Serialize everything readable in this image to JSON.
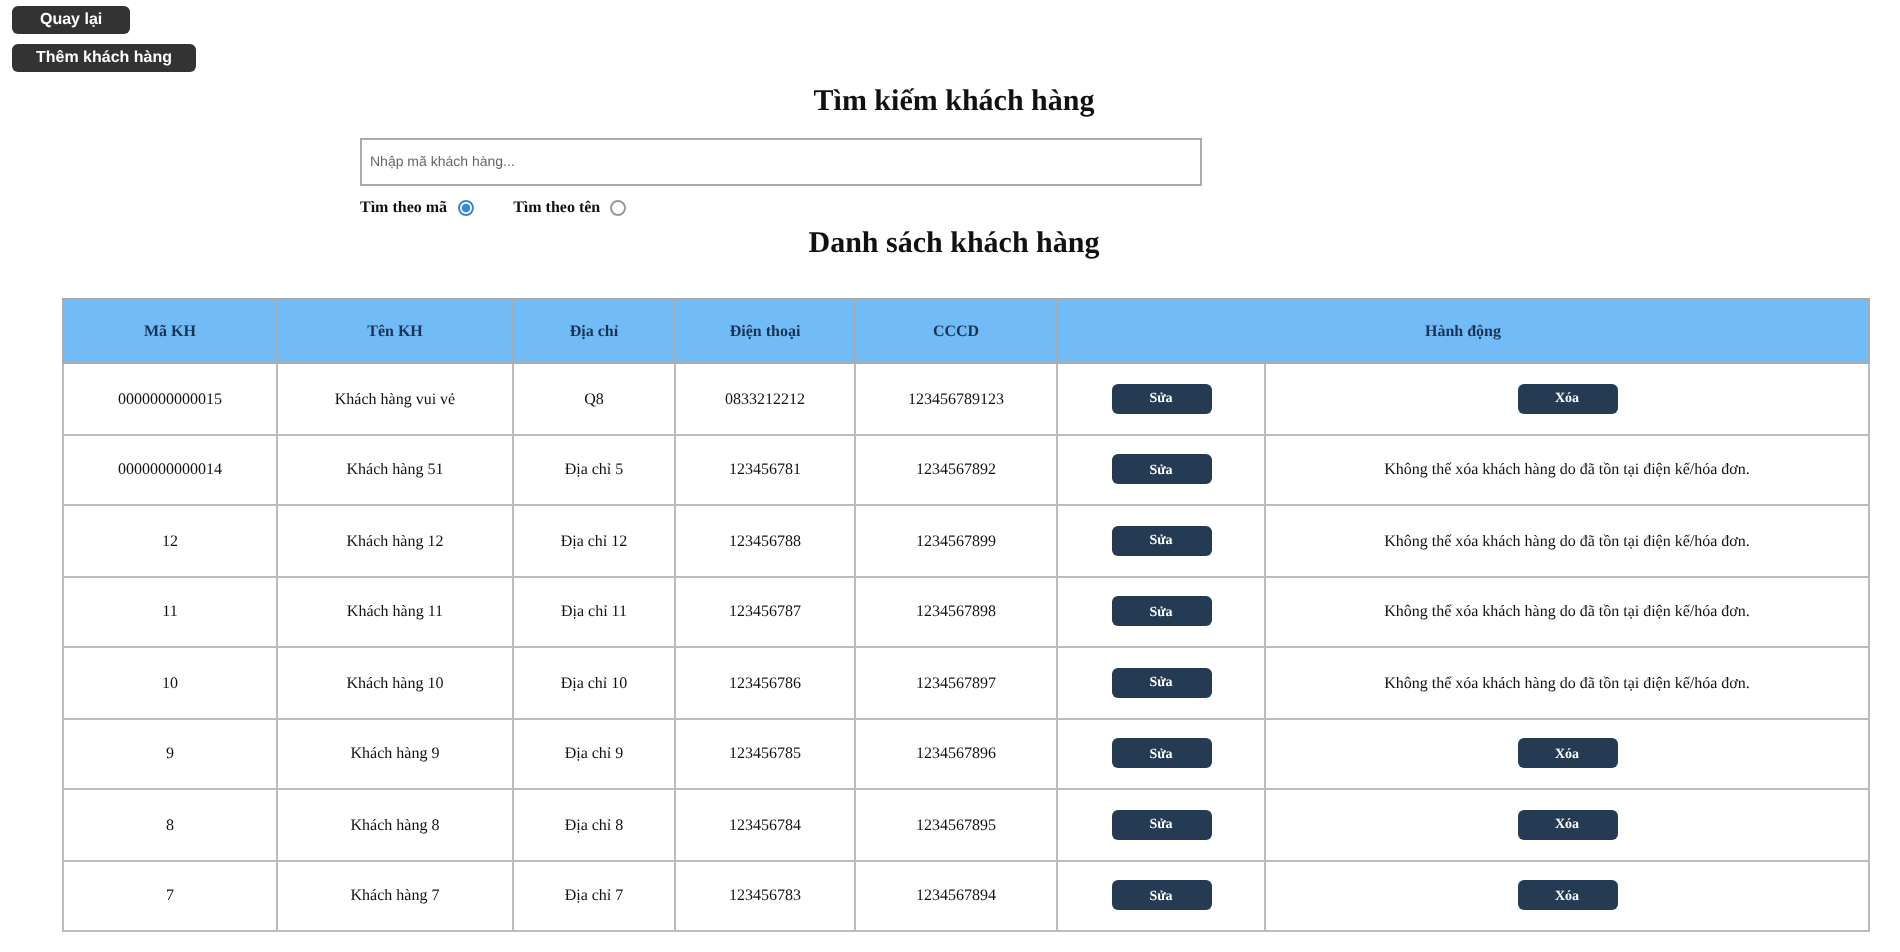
{
  "top_buttons": [
    "Quay lại",
    "Thêm khách hàng"
  ],
  "search_title": "Tìm kiếm khách hàng",
  "search": {
    "placeholder": "Nhập mã khách hàng..."
  },
  "search_modes": [
    {
      "label": "Tìm theo mã",
      "selected": true
    },
    {
      "label": "Tìm theo tên",
      "selected": false
    }
  ],
  "list_title": "Danh sách khách hàng",
  "table": {
    "columns": [
      "Mã KH",
      "Tên KH",
      "Địa chỉ",
      "Điện thoại",
      "CCCD",
      "Hành động"
    ],
    "rows": [
      {
        "cells": [
          "0000000000015",
          "Khách hàng vui vẻ",
          "Q8",
          "0833212212",
          "123456789123"
        ],
        "edit": "Sửa",
        "action": {
          "kind": "delete",
          "text": "Xóa"
        }
      },
      {
        "cells": [
          "0000000000014",
          "Khách hàng 51",
          "Địa chỉ 5",
          "123456781",
          "1234567892"
        ],
        "edit": "Sửa",
        "action": {
          "kind": "note",
          "text": "Không thể xóa khách hàng do đã tồn tại điện kế/hóa đơn."
        }
      },
      {
        "cells": [
          "12",
          "Khách hàng 12",
          "Địa chỉ 12",
          "123456788",
          "1234567899"
        ],
        "edit": "Sửa",
        "action": {
          "kind": "note",
          "text": "Không thể xóa khách hàng do đã tồn tại điện kế/hóa đơn."
        }
      },
      {
        "cells": [
          "11",
          "Khách hàng 11",
          "Địa chỉ 11",
          "123456787",
          "1234567898"
        ],
        "edit": "Sửa",
        "action": {
          "kind": "note",
          "text": "Không thể xóa khách hàng do đã tồn tại điện kế/hóa đơn."
        }
      },
      {
        "cells": [
          "10",
          "Khách hàng 10",
          "Địa chỉ 10",
          "123456786",
          "1234567897"
        ],
        "edit": "Sửa",
        "action": {
          "kind": "note",
          "text": "Không thể xóa khách hàng do đã tồn tại điện kế/hóa đơn."
        }
      },
      {
        "cells": [
          "9",
          "Khách hàng 9",
          "Địa chỉ 9",
          "123456785",
          "1234567896"
        ],
        "edit": "Sửa",
        "action": {
          "kind": "delete",
          "text": "Xóa"
        }
      },
      {
        "cells": [
          "8",
          "Khách hàng 8",
          "Địa chỉ 8",
          "123456784",
          "1234567895"
        ],
        "edit": "Sửa",
        "action": {
          "kind": "delete",
          "text": "Xóa"
        }
      },
      {
        "cells": [
          "7",
          "Khách hàng 7",
          "Địa chỉ 7",
          "123456783",
          "1234567894"
        ],
        "edit": "Sửa",
        "action": {
          "kind": "delete",
          "text": "Xóa"
        }
      }
    ]
  }
}
